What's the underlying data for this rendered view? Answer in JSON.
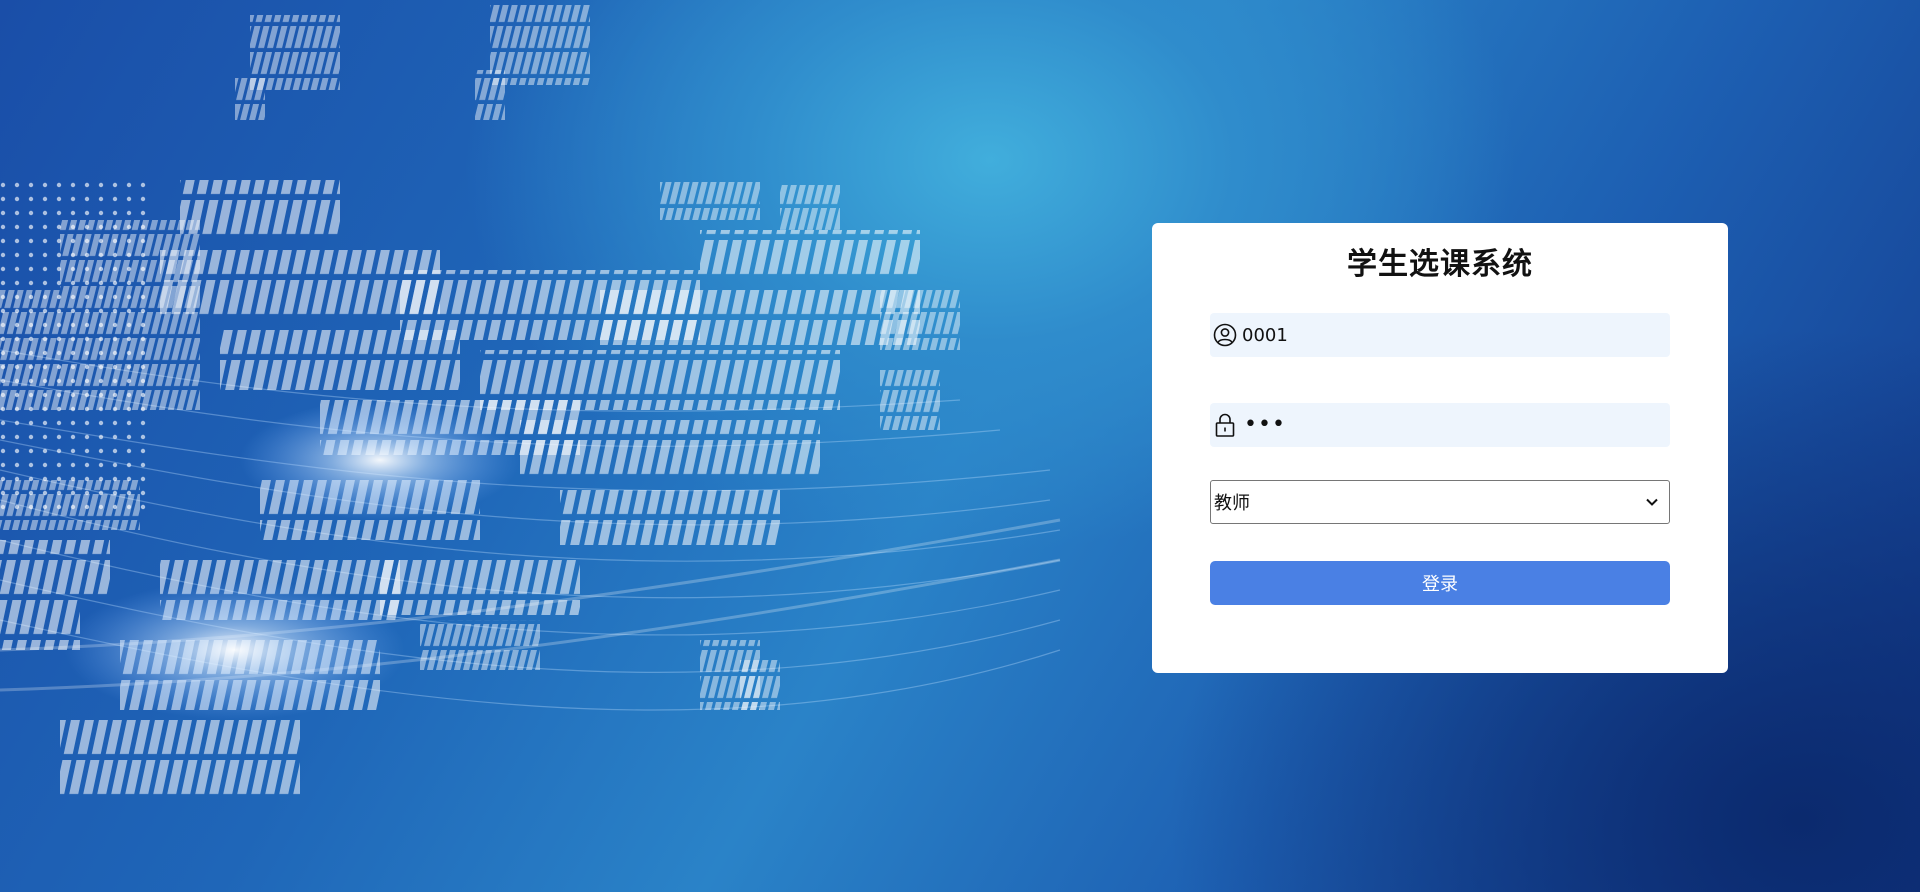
{
  "app": {
    "title": "学生选课系统"
  },
  "login": {
    "username_value": "0001",
    "password_mask": "•••",
    "role_selected": "教师",
    "submit_label": "登录"
  },
  "icons": {
    "username": "user-circle-icon",
    "password": "lock-icon",
    "select": "chevron-down-icon"
  },
  "colors": {
    "button": "#4a80e4",
    "field_bg": "#eef5fd",
    "card_bg": "#ffffff"
  }
}
